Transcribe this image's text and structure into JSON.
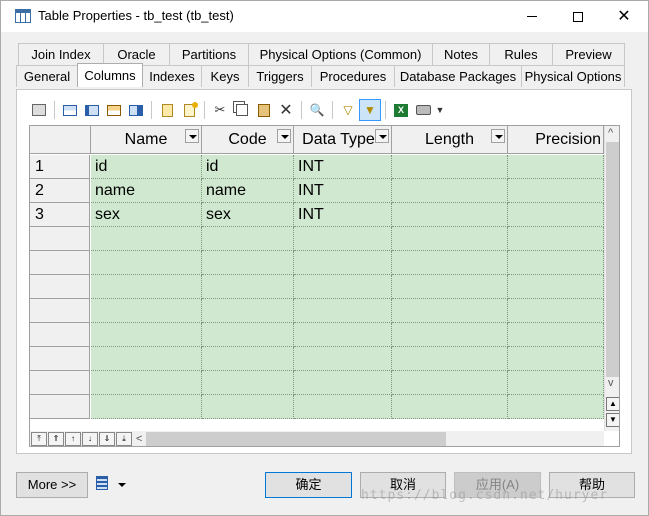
{
  "window": {
    "title": "Table Properties - tb_test (tb_test)"
  },
  "tabs": {
    "back_row": [
      "Join Index",
      "Oracle",
      "Partitions",
      "Physical Options (Common)",
      "Notes",
      "Rules",
      "Preview"
    ],
    "front_row": [
      "General",
      "Columns",
      "Indexes",
      "Keys",
      "Triggers",
      "Procedures",
      "Database Packages",
      "Physical Options"
    ],
    "active": "Columns"
  },
  "toolbar": {
    "icons": [
      "properties-icon",
      "add-row-icon",
      "insert-row-icon",
      "add-attribute-icon",
      "add-column-icon",
      "new-document-icon",
      "reuse-icon",
      "cut-icon",
      "copy-icon",
      "paste-icon",
      "delete-icon",
      "find-icon",
      "filter-icon",
      "customize-columns-icon",
      "excel-export-icon",
      "print-icon"
    ]
  },
  "grid": {
    "columns": [
      "Name",
      "Code",
      "Data Type",
      "Length",
      "Precision"
    ],
    "rows": [
      {
        "num": "1",
        "name": "id",
        "code": "id",
        "data_type": "INT",
        "length": "",
        "precision": ""
      },
      {
        "num": "2",
        "name": "name",
        "code": "name",
        "data_type": "INT",
        "length": "",
        "precision": ""
      },
      {
        "num": "3",
        "name": "sex",
        "code": "sex",
        "data_type": "INT",
        "length": "",
        "precision": ""
      }
    ],
    "empty_row_count": 9
  },
  "buttons": {
    "more": "More >>",
    "ok": "确定",
    "cancel": "取消",
    "apply": "应用(A)",
    "help": "帮助"
  },
  "watermark": "https://blog.csdn.net/huryer"
}
